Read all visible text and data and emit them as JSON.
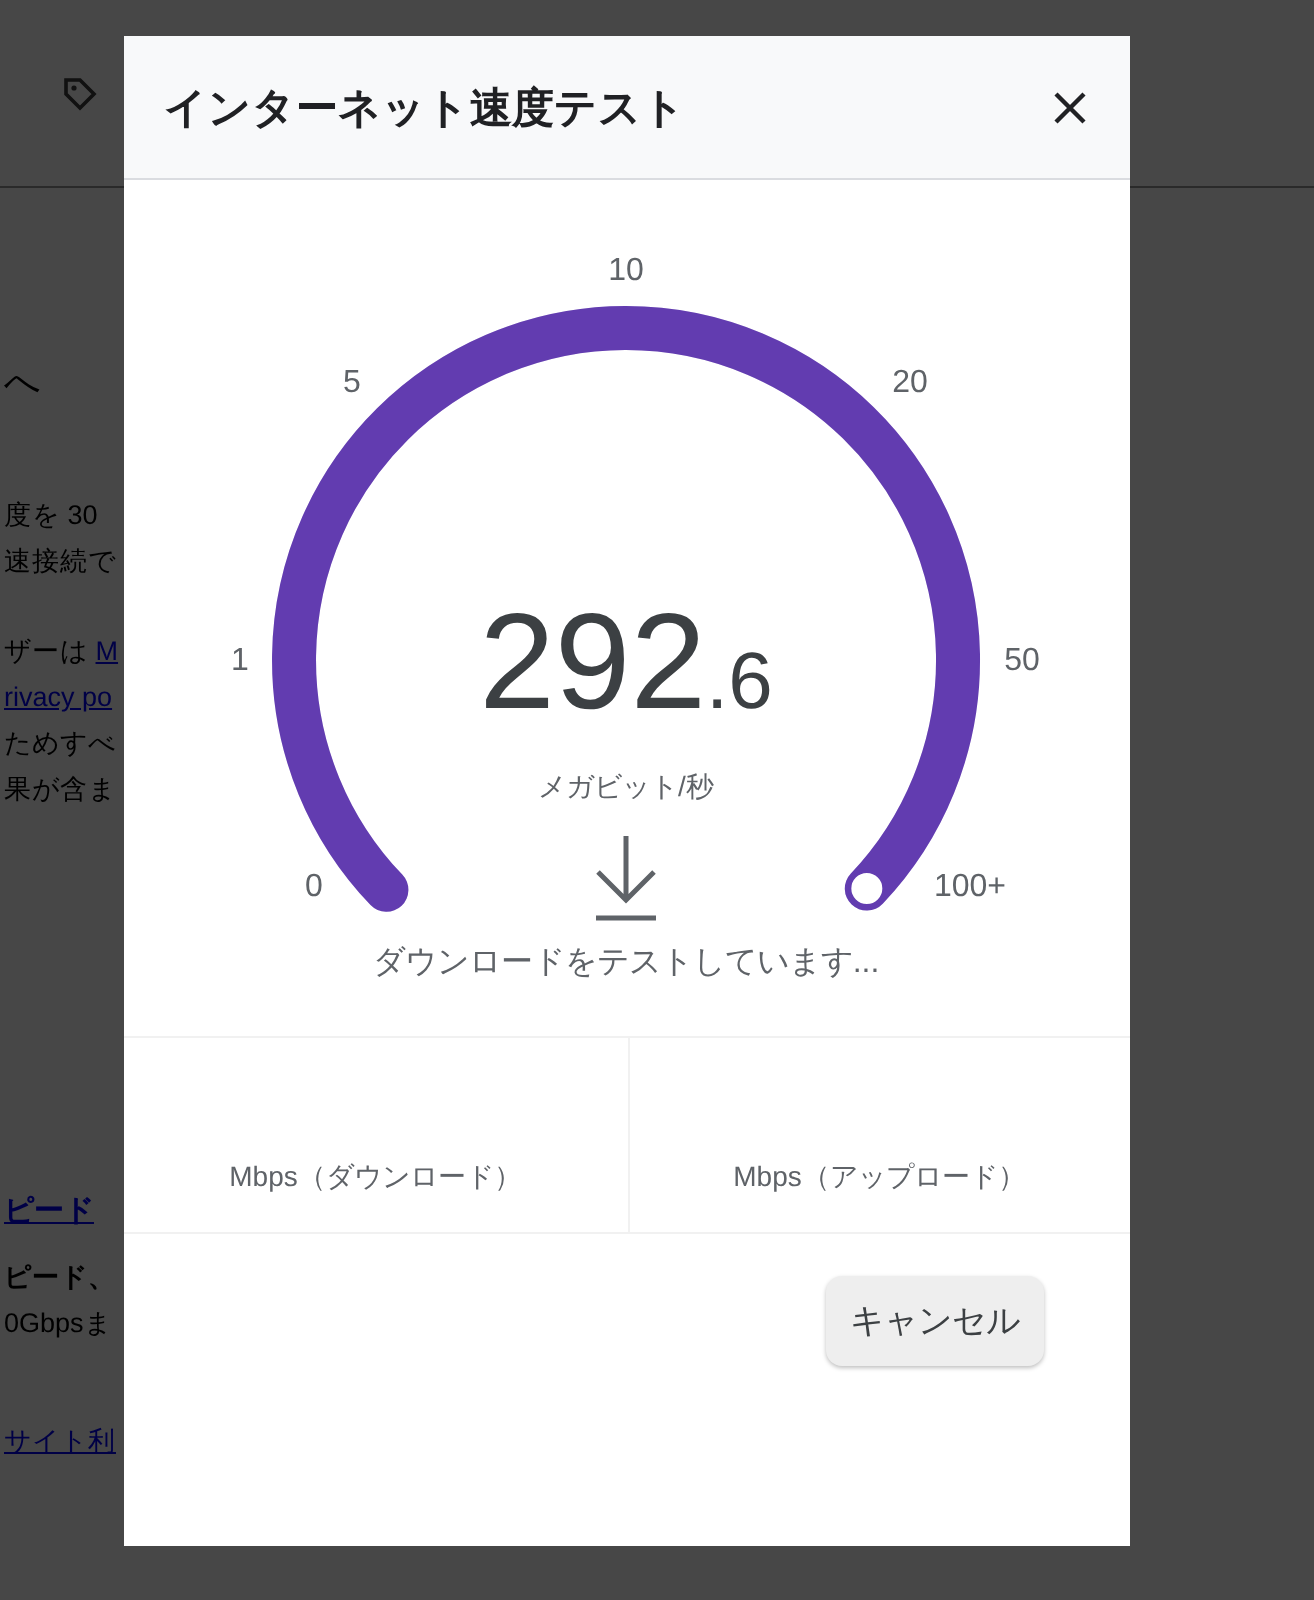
{
  "background": {
    "lines": [
      {
        "kind": "heading",
        "spans": [
          {
            "text": "へ",
            "link": false
          }
        ]
      },
      {
        "kind": "text",
        "spans": [
          {
            "text": "度を 30",
            "link": false
          }
        ]
      },
      {
        "kind": "text",
        "spans": [
          {
            "text": "速接続で",
            "link": false
          }
        ]
      },
      {
        "kind": "para",
        "spans": [
          {
            "text": "ザーは ",
            "link": false
          },
          {
            "text": "M",
            "link": true
          }
        ]
      },
      {
        "kind": "text",
        "spans": [
          {
            "text": "rivacy po",
            "link": true
          }
        ]
      },
      {
        "kind": "text",
        "spans": [
          {
            "text": "ためすべ",
            "link": false
          }
        ]
      },
      {
        "kind": "text",
        "spans": [
          {
            "text": "果が含ま",
            "link": false
          }
        ]
      },
      {
        "kind": "title",
        "spans": [
          {
            "text": "ピード",
            "link": true
          }
        ]
      },
      {
        "kind": "bold",
        "spans": [
          {
            "text": "ピード、",
            "link": false
          }
        ]
      },
      {
        "kind": "text",
        "spans": [
          {
            "text": "0Gbpsま",
            "link": false
          }
        ]
      },
      {
        "kind": "para",
        "spans": [
          {
            "text": "サイト利",
            "link": true
          }
        ]
      }
    ]
  },
  "dialog": {
    "title": "インターネット速度テスト",
    "gauge": {
      "ticks": [
        "0",
        "1",
        "5",
        "10",
        "20",
        "50",
        "100+"
      ],
      "level": 1,
      "value_integer": "292",
      "value_decimal": ".6",
      "unit": "メガビット/秒",
      "status": "ダウンロードをテストしています..."
    },
    "results": [
      {
        "label": "Mbps（ダウンロード）"
      },
      {
        "label": "Mbps（アップロード）"
      }
    ],
    "buttons": [
      "キャンセル"
    ]
  }
}
